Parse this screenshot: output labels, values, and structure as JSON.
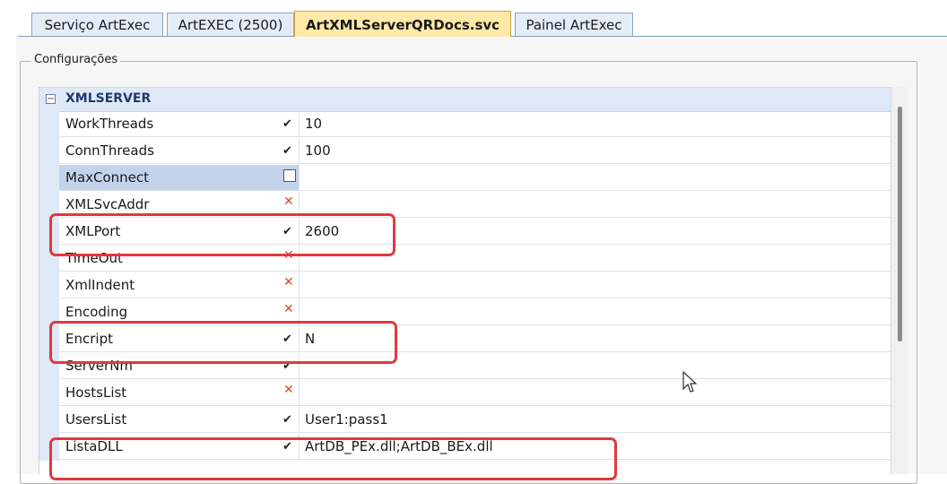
{
  "tabs": [
    {
      "label": "Serviço ArtExec"
    },
    {
      "label": "ArtEXEC (2500)"
    },
    {
      "label": "ArtXMLServerQRDocs.svc"
    },
    {
      "label": "Painel ArtExec"
    }
  ],
  "group": {
    "label": "Configurações"
  },
  "category": {
    "label": "XMLSERVER"
  },
  "rows": [
    {
      "name": "WorkThreads",
      "value": "10"
    },
    {
      "name": "ConnThreads",
      "value": "100"
    },
    {
      "name": "MaxConnect",
      "value": ""
    },
    {
      "name": "XMLSvcAddr",
      "value": ""
    },
    {
      "name": "XMLPort",
      "value": "2600"
    },
    {
      "name": "TimeOut",
      "value": ""
    },
    {
      "name": "XmlIndent",
      "value": ""
    },
    {
      "name": "Encoding",
      "value": ""
    },
    {
      "name": "Encript",
      "value": "N"
    },
    {
      "name": "ServerNm",
      "value": ""
    },
    {
      "name": "HostsList",
      "value": ""
    },
    {
      "name": "UsersList",
      "value": "User1:pass1"
    },
    {
      "name": "ListaDLL",
      "value": "ArtDB_PEx.dll;ArtDB_BEx.dll"
    }
  ],
  "colors": {
    "highlight": "#e0393e",
    "active_tab": "#ffe9a8",
    "category": "#1f3a6e"
  }
}
